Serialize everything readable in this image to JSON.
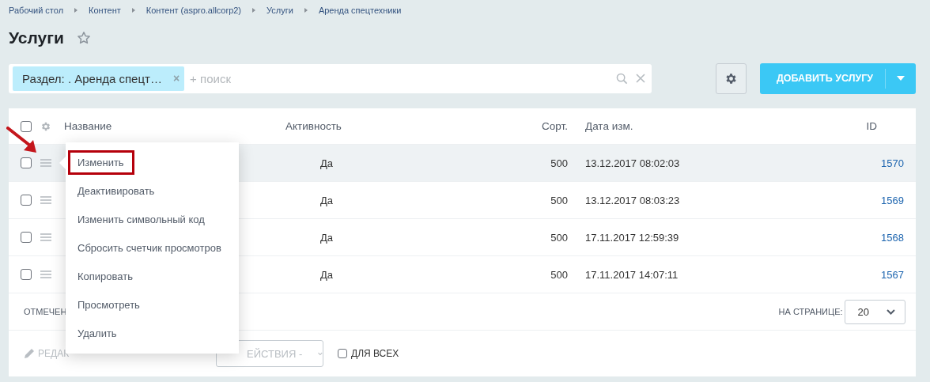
{
  "breadcrumbs": [
    "Рабочий стол",
    "Контент",
    "Контент (aspro.allcorp2)",
    "Услуги",
    "Аренда спецтехники"
  ],
  "title": "Услуги",
  "favorite": false,
  "filter": {
    "tag": "Раздел: . Аренда спецт…",
    "remove": "×",
    "placeholder": "+ поиск"
  },
  "add_button": {
    "label": "ДОБАВИТЬ УСЛУГУ"
  },
  "table": {
    "columns": [
      "Название",
      "Активность",
      "Сорт.",
      "Дата изм.",
      "ID"
    ],
    "select_all_checked": false,
    "rows": [
      {
        "checked": false,
        "hovered": true,
        "active": "Да",
        "sort": "500",
        "modified": "13.12.2017 08:02:03",
        "id": "1570"
      },
      {
        "checked": false,
        "hovered": false,
        "active": "Да",
        "sort": "500",
        "modified": "13.12.2017 08:03:23",
        "id": "1569"
      },
      {
        "checked": false,
        "hovered": false,
        "active": "Да",
        "sort": "500",
        "modified": "17.11.2017 12:59:39",
        "id": "1568"
      },
      {
        "checked": false,
        "hovered": false,
        "active": "Да",
        "sort": "500",
        "modified": "17.11.2017 14:07:11",
        "id": "1567"
      }
    ]
  },
  "footer": {
    "selected_label": "ОТМЕЧЕН",
    "page_size_label": "НА СТРАНИЦЕ:",
    "page_size": "20"
  },
  "actions": {
    "edit": {
      "label": "РЕДАК",
      "disabled": true
    },
    "select": "ЕЙСТВИЯ -",
    "for_all": {
      "label": "ДЛЯ ВСЕХ",
      "checked": false
    }
  },
  "context_menu": {
    "items": [
      {
        "label": "Изменить",
        "highlighted": true
      },
      {
        "label": "Деактивировать",
        "highlighted": false
      },
      {
        "label": "Изменить символьный код",
        "highlighted": false
      },
      {
        "label": "Сбросить счетчик просмотров",
        "highlighted": false
      },
      {
        "label": "Копировать",
        "highlighted": false
      },
      {
        "label": "Просмотреть",
        "highlighted": false
      },
      {
        "label": "Удалить",
        "highlighted": false
      }
    ]
  }
}
